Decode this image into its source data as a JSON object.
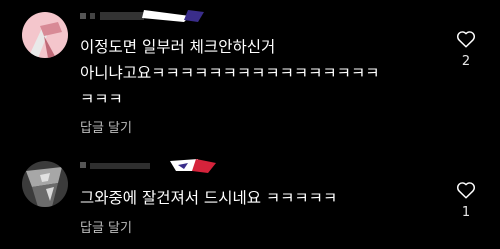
{
  "comments": [
    {
      "text_lines": [
        "이정도면 일부러 체크안하신거",
        "아니냐고요ㅋㅋㅋㅋㅋㅋㅋㅋㅋㅋㅋㅋㅋㅋㅋㅋ",
        "ㅋㅋㅋ"
      ],
      "reply_label": "답글 달기",
      "like_count": "2"
    },
    {
      "text_lines": [
        "그와중에 잘건져서 드시네요 ㅋㅋㅋㅋㅋ"
      ],
      "reply_label": "답글 달기",
      "like_count": "1"
    }
  ],
  "colors": {
    "background": "#000000",
    "text": "#ffffff",
    "secondary_text": "#bdbdbd",
    "avatar_1": "#f4c6cc",
    "avatar_2": "#4a4a4a",
    "heart_outline": "#ffffff"
  },
  "icons": {
    "like": "heart-outline-icon"
  }
}
